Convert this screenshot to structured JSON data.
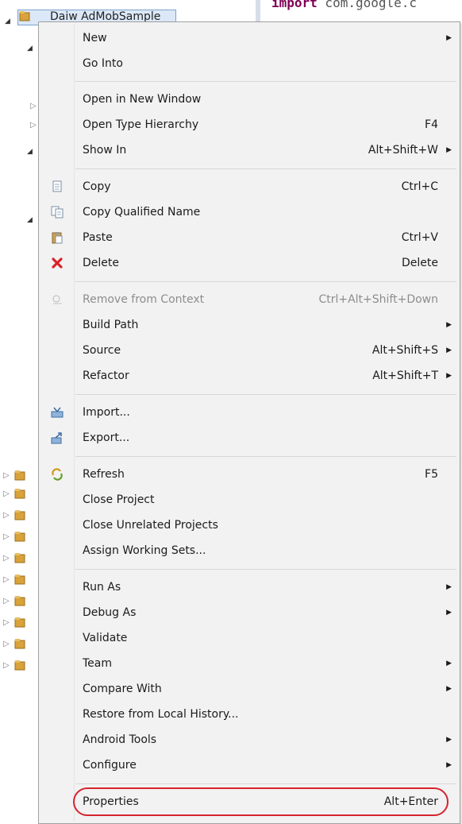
{
  "editor": {
    "code_keyword": "import",
    "code_rest": " com.google.c"
  },
  "explorer": {
    "root_label": "Daiw AdMobSample"
  },
  "menu": {
    "items": [
      {
        "label": "New",
        "accel": "",
        "submenu": true
      },
      {
        "label": "Go Into",
        "accel": "",
        "submenu": false
      },
      {
        "label": "Open in New Window",
        "accel": "",
        "submenu": false
      },
      {
        "label": "Open Type Hierarchy",
        "accel": "F4",
        "submenu": false
      },
      {
        "label": "Show In",
        "accel": "Alt+Shift+W",
        "submenu": true
      },
      {
        "label": "Copy",
        "accel": "Ctrl+C",
        "submenu": false,
        "icon": "copy-icon"
      },
      {
        "label": "Copy Qualified Name",
        "accel": "",
        "submenu": false,
        "icon": "copy-qualified-name-icon"
      },
      {
        "label": "Paste",
        "accel": "Ctrl+V",
        "submenu": false,
        "icon": "paste-icon"
      },
      {
        "label": "Delete",
        "accel": "Delete",
        "submenu": false,
        "icon": "delete-icon"
      },
      {
        "label": "Remove from Context",
        "accel": "Ctrl+Alt+Shift+Down",
        "submenu": false,
        "disabled": true,
        "icon": "remove-context-icon"
      },
      {
        "label": "Build Path",
        "accel": "",
        "submenu": true
      },
      {
        "label": "Source",
        "accel": "Alt+Shift+S",
        "submenu": true
      },
      {
        "label": "Refactor",
        "accel": "Alt+Shift+T",
        "submenu": true
      },
      {
        "label": "Import...",
        "accel": "",
        "submenu": false,
        "icon": "import-icon"
      },
      {
        "label": "Export...",
        "accel": "",
        "submenu": false,
        "icon": "export-icon"
      },
      {
        "label": "Refresh",
        "accel": "F5",
        "submenu": false,
        "icon": "refresh-icon"
      },
      {
        "label": "Close Project",
        "accel": "",
        "submenu": false
      },
      {
        "label": "Close Unrelated Projects",
        "accel": "",
        "submenu": false
      },
      {
        "label": "Assign Working Sets...",
        "accel": "",
        "submenu": false
      },
      {
        "label": "Run As",
        "accel": "",
        "submenu": true
      },
      {
        "label": "Debug As",
        "accel": "",
        "submenu": true
      },
      {
        "label": "Validate",
        "accel": "",
        "submenu": false
      },
      {
        "label": "Team",
        "accel": "",
        "submenu": true
      },
      {
        "label": "Compare With",
        "accel": "",
        "submenu": true
      },
      {
        "label": "Restore from Local History...",
        "accel": "",
        "submenu": false
      },
      {
        "label": "Android Tools",
        "accel": "",
        "submenu": true
      },
      {
        "label": "Configure",
        "accel": "",
        "submenu": true
      },
      {
        "label": "Properties",
        "accel": "Alt+Enter",
        "submenu": false,
        "highlighted": true
      }
    ]
  },
  "colors": {
    "highlight_ring": "#d6232e",
    "menu_bg": "#f2f2f2"
  }
}
